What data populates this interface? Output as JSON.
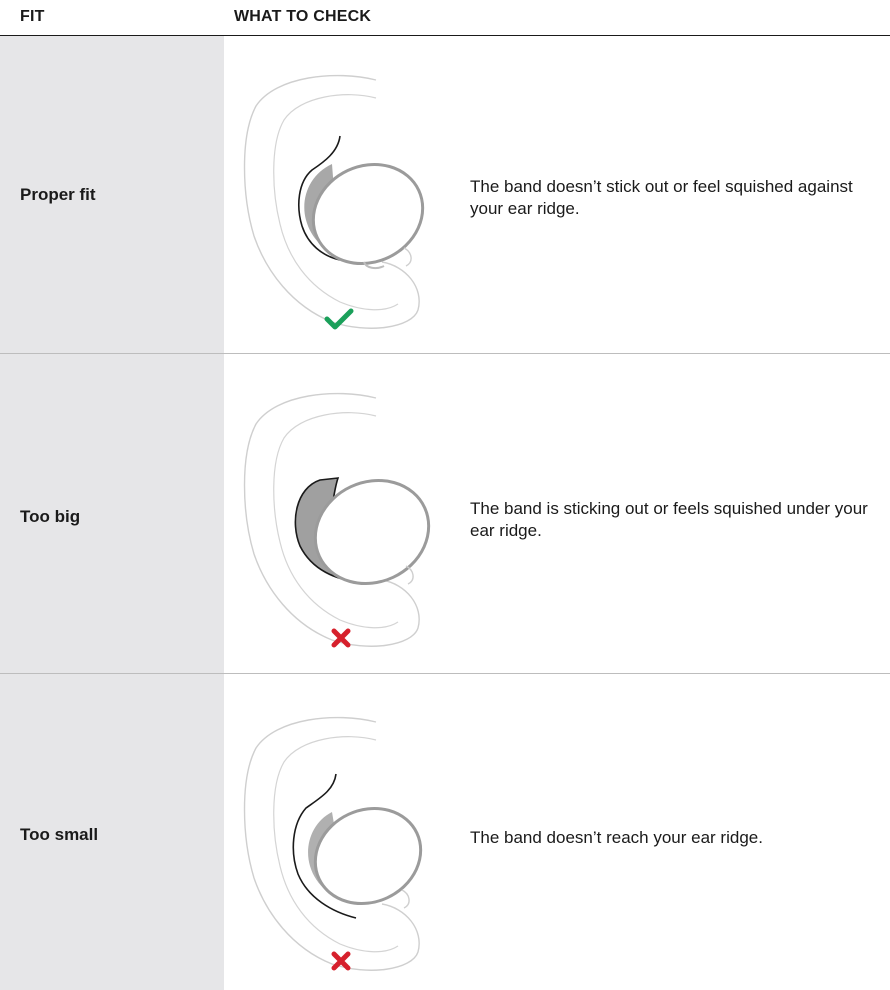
{
  "header": {
    "fit": "FIT",
    "what_to_check": "WHAT TO CHECK"
  },
  "rows": [
    {
      "fit": "Proper fit",
      "description": "The band doesn’t stick out or feel squished against your ear ridge.",
      "status": "check",
      "status_color": "#1aa05a"
    },
    {
      "fit": "Too big",
      "description": "The band is sticking out or feels squished under your ear ridge.",
      "status": "cross",
      "status_color": "#d6202c"
    },
    {
      "fit": "Too small",
      "description": "The band doesn’t reach your ear ridge.",
      "status": "cross",
      "status_color": "#d6202c"
    }
  ]
}
